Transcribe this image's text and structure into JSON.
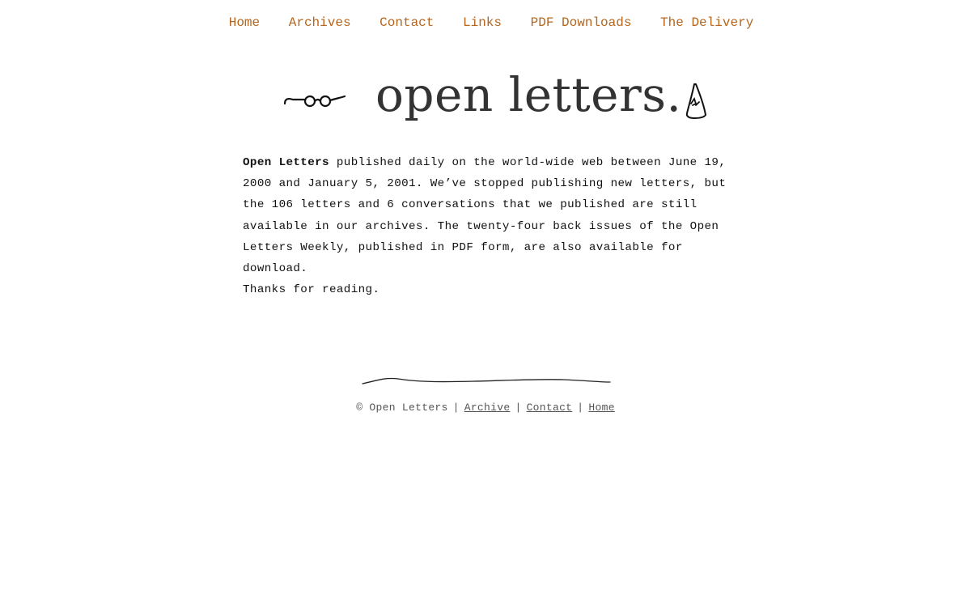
{
  "nav": {
    "items": [
      {
        "label": "Home"
      },
      {
        "label": "Archives"
      },
      {
        "label": "Contact"
      },
      {
        "label": "Links"
      },
      {
        "label": "PDF Downloads"
      },
      {
        "label": "The Delivery"
      }
    ]
  },
  "masthead": {
    "title": "open letters.",
    "left_icon": "glasses-icon",
    "right_icon": "hat-icon"
  },
  "intro": {
    "lead": "Open Letters",
    "body_1": " published daily on the world-wide web between June 19, 2000 and January 5, 2001. We’ve stopped publishing new letters, but the 106 letters and 6 conversations that we published are still available in our archives. The twenty-four back issues of the Open Letters Weekly, published in PDF form, are also available for download.",
    "thanks": "Thanks for reading."
  },
  "footer": {
    "copyright": "© Open Letters",
    "separator": "|",
    "links": [
      {
        "label": "Archive"
      },
      {
        "label": "Contact"
      },
      {
        "label": "Home"
      }
    ]
  },
  "colors": {
    "nav_link": "#b5651d",
    "title": "#333333",
    "body_text": "#111111",
    "footer_text": "#555555"
  }
}
